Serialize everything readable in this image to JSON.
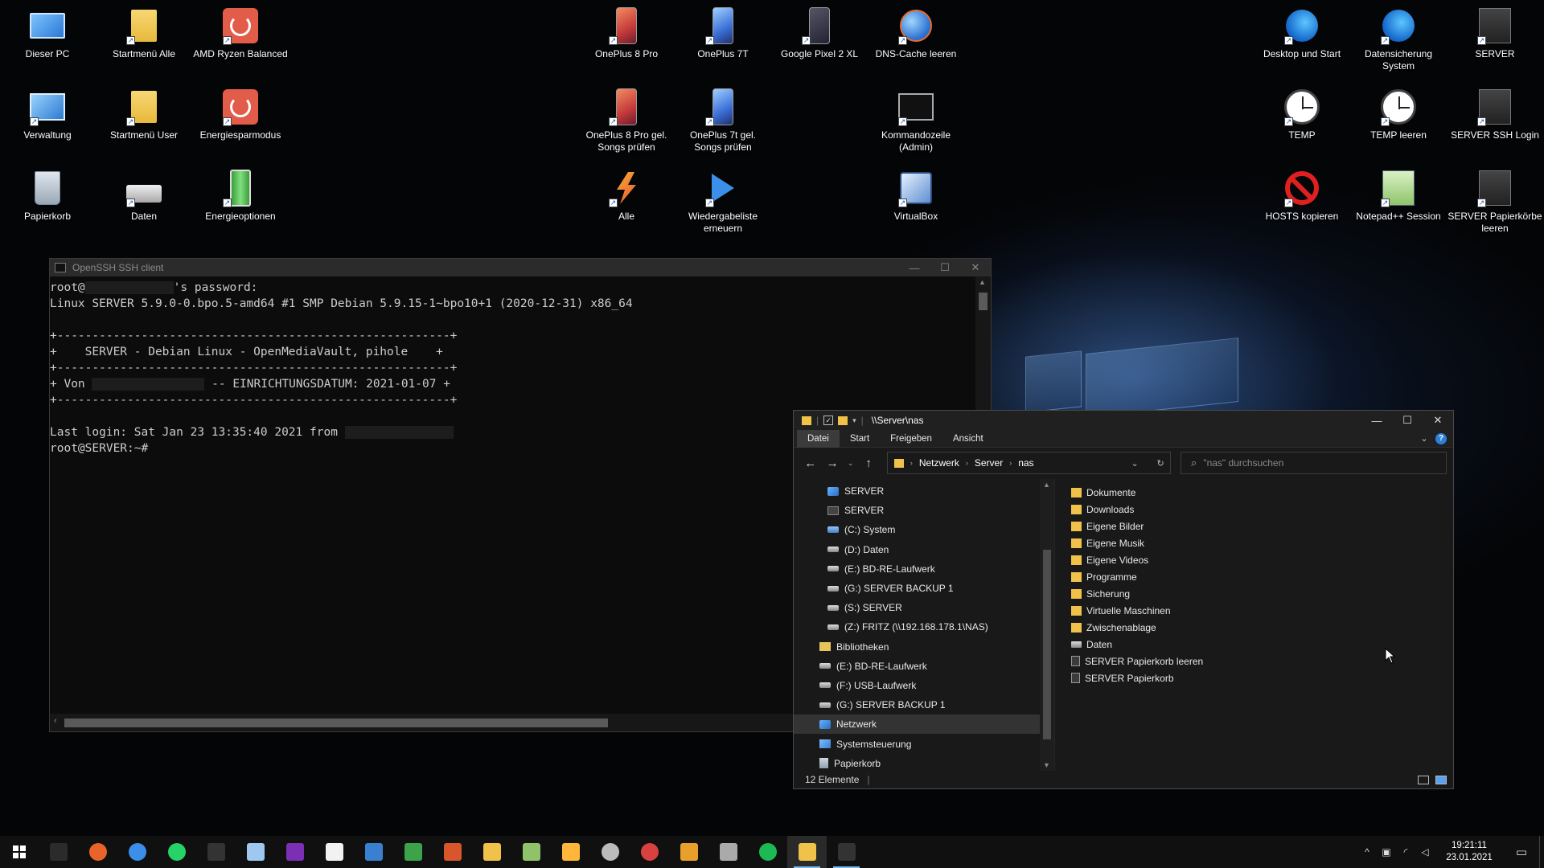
{
  "desktop_icons": [
    {
      "label": "Dieser PC",
      "icon": "pc-icon"
    },
    {
      "label": "Startmenü Alle",
      "icon": "folder-icon"
    },
    {
      "label": "AMD Ryzen Balanced",
      "icon": "power-icon"
    },
    {
      "label": "Verwaltung",
      "icon": "admin-icon"
    },
    {
      "label": "Startmenü User",
      "icon": "folder-icon"
    },
    {
      "label": "Energiesparmodus",
      "icon": "power-icon"
    },
    {
      "label": "Papierkorb",
      "icon": "recycle-bin-icon"
    },
    {
      "label": "Daten",
      "icon": "drive-icon"
    },
    {
      "label": "Energieoptionen",
      "icon": "battery-icon"
    },
    {
      "label": "OnePlus 8 Pro",
      "icon": "phone-icon"
    },
    {
      "label": "OnePlus 7T",
      "icon": "phone-icon"
    },
    {
      "label": "Google Pixel 2 XL",
      "icon": "phone-icon"
    },
    {
      "label": "DNS-Cache leeren",
      "icon": "globe-icon"
    },
    {
      "label": "OnePlus 8 Pro gel. Songs prüfen",
      "icon": "phone-icon"
    },
    {
      "label": "OnePlus 7t gel. Songs prüfen",
      "icon": "phone-icon"
    },
    {
      "label": "Kommandozeile (Admin)",
      "icon": "command-prompt-icon"
    },
    {
      "label": "Alle",
      "icon": "lightning-icon"
    },
    {
      "label": "Wiedergabeliste erneuern",
      "icon": "play-arrow-icon"
    },
    {
      "label": "VirtualBox",
      "icon": "virtualbox-icon"
    },
    {
      "label": "Desktop und Start",
      "icon": "edge-icon"
    },
    {
      "label": "Datensicherung System",
      "icon": "edge-icon"
    },
    {
      "label": "SERVER",
      "icon": "server-icon"
    },
    {
      "label": "TEMP",
      "icon": "clock-icon"
    },
    {
      "label": "TEMP leeren",
      "icon": "clock-icon"
    },
    {
      "label": "SERVER SSH Login",
      "icon": "server-icon"
    },
    {
      "label": "HOSTS kopieren",
      "icon": "ban-icon"
    },
    {
      "label": "Notepad++ Session",
      "icon": "notepad-icon"
    },
    {
      "label": "SERVER Papierkörbe leeren",
      "icon": "server-icon"
    }
  ],
  "ssh_window": {
    "title": "OpenSSH SSH client",
    "controls": {
      "minimize": "—",
      "maximize": "☐",
      "close": "✕"
    },
    "lines": {
      "l1a": "root@",
      "l1b": "'s password:",
      "l2": "Linux SERVER 5.9.0-0.bpo.5-amd64 #1 SMP Debian 5.9.15-1~bpo10+1 (2020-12-31) x86_64",
      "l3": "",
      "l4": "+--------------------------------------------------------+",
      "l5": "+    SERVER - Debian Linux - OpenMediaVault, pihole    +",
      "l6": "+--------------------------------------------------------+",
      "l7a": "+ Von",
      "l7b": "-- EINRICHTUNGSDATUM: 2021-01-07 +",
      "l8": "+--------------------------------------------------------+",
      "l9": "",
      "l10a": "Last login: Sat Jan 23 13:35:40 2021 from",
      "l11": "root@SERVER:~#"
    }
  },
  "explorer": {
    "title": "\\\\Server\\nas",
    "controls": {
      "minimize": "—",
      "maximize": "☐",
      "close": "✕"
    },
    "ribbon_tabs": [
      "Datei",
      "Start",
      "Freigeben",
      "Ansicht"
    ],
    "breadcrumb": [
      "Netzwerk",
      "Server",
      "nas"
    ],
    "search_placeholder": "\"nas\" durchsuchen",
    "tree": [
      {
        "label": "SERVER",
        "indent": 2,
        "icon": "ico-net"
      },
      {
        "label": "SERVER",
        "indent": 2,
        "icon": "ico-server"
      },
      {
        "label": "(C:) System",
        "indent": 2,
        "icon": "ico-sysdrive"
      },
      {
        "label": "(D:) Daten",
        "indent": 2,
        "icon": "ico-drive"
      },
      {
        "label": "(E:) BD-RE-Laufwerk",
        "indent": 2,
        "icon": "ico-drive"
      },
      {
        "label": "(G:) SERVER BACKUP 1",
        "indent": 2,
        "icon": "ico-drive"
      },
      {
        "label": "(S:) SERVER",
        "indent": 2,
        "icon": "ico-drive"
      },
      {
        "label": "(Z:) FRITZ (\\\\192.168.178.1\\NAS)",
        "indent": 2,
        "icon": "ico-drive"
      },
      {
        "label": "Bibliotheken",
        "indent": 1,
        "icon": "ico-lib"
      },
      {
        "label": "(E:) BD-RE-Laufwerk",
        "indent": 1,
        "icon": "ico-drive"
      },
      {
        "label": "(F:) USB-Laufwerk",
        "indent": 1,
        "icon": "ico-drive"
      },
      {
        "label": "(G:) SERVER BACKUP 1",
        "indent": 1,
        "icon": "ico-drive"
      },
      {
        "label": "Netzwerk",
        "indent": 1,
        "icon": "ico-net",
        "selected": true
      },
      {
        "label": "Systemsteuerung",
        "indent": 1,
        "icon": "ico-ctrl"
      },
      {
        "label": "Papierkorb",
        "indent": 1,
        "icon": "ico-trash"
      }
    ],
    "files": [
      {
        "label": "Dokumente",
        "type": "folder"
      },
      {
        "label": "Downloads",
        "type": "folder"
      },
      {
        "label": "Eigene Bilder",
        "type": "folder"
      },
      {
        "label": "Eigene Musik",
        "type": "folder"
      },
      {
        "label": "Eigene Videos",
        "type": "folder"
      },
      {
        "label": "Programme",
        "type": "folder"
      },
      {
        "label": "Sicherung",
        "type": "folder"
      },
      {
        "label": "Virtuelle Maschinen",
        "type": "folder"
      },
      {
        "label": "Zwischenablage",
        "type": "folder"
      },
      {
        "label": "Daten",
        "type": "drive"
      },
      {
        "label": "SERVER Papierkorb leeren",
        "type": "link"
      },
      {
        "label": "SERVER Papierkorb",
        "type": "link"
      }
    ],
    "status": "12 Elemente"
  },
  "taskbar": {
    "apps": [
      {
        "name": "terminal",
        "color": "#2b2b2b"
      },
      {
        "name": "firefox",
        "color": "#e8642b"
      },
      {
        "name": "thunderbird",
        "color": "#3b8fe8"
      },
      {
        "name": "whatsapp",
        "color": "#25d366"
      },
      {
        "name": "ssh-console",
        "color": "#333333"
      },
      {
        "name": "notepad",
        "color": "#9ec8f0"
      },
      {
        "name": "onenote",
        "color": "#7b2fb5"
      },
      {
        "name": "document",
        "color": "#f2f2f2"
      },
      {
        "name": "writer",
        "color": "#3b7fd0"
      },
      {
        "name": "calc",
        "color": "#3ca34a"
      },
      {
        "name": "impress",
        "color": "#d9552b"
      },
      {
        "name": "file-note",
        "color": "#f0c24a"
      },
      {
        "name": "notepad-plus-plus",
        "color": "#8fc36a"
      },
      {
        "name": "lightning-tool",
        "color": "#ffb63b"
      },
      {
        "name": "shield-tool",
        "color": "#bbbbbb"
      },
      {
        "name": "rainbow-tool",
        "color": "#d94040"
      },
      {
        "name": "checklist-tool",
        "color": "#e8a02b"
      },
      {
        "name": "chart-tool",
        "color": "#aaaaaa"
      },
      {
        "name": "spotify",
        "color": "#1db954"
      },
      {
        "name": "file-explorer",
        "color": "#f0c24a",
        "active": true
      },
      {
        "name": "ssh-client",
        "color": "#333333",
        "running": true
      }
    ],
    "time": "19:21:11",
    "date": "23.01.2021"
  }
}
